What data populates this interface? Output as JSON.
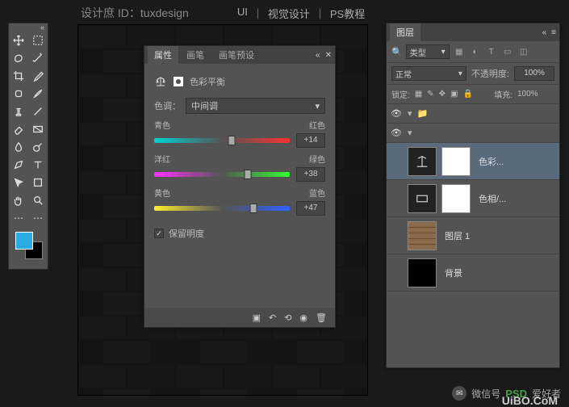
{
  "topbar": {
    "id_label": "设计庶 ID：tuxdesign",
    "sections": [
      "UI",
      "视觉设计",
      "PS教程"
    ]
  },
  "swatch": {
    "fg": "#29abe2"
  },
  "properties": {
    "tabs": [
      "属性",
      "画笔",
      "画笔预设"
    ],
    "title": "色彩平衡",
    "tone_label": "色调：",
    "tone_value": "中间调",
    "sliders": [
      {
        "left": "青色",
        "right": "红色",
        "value": "+14",
        "pos": 57
      },
      {
        "left": "洋红",
        "right": "绿色",
        "value": "+38",
        "pos": 69
      },
      {
        "left": "黄色",
        "right": "蓝色",
        "value": "+47",
        "pos": 73
      }
    ],
    "preserve": "保留明度"
  },
  "layers": {
    "tab": "图层",
    "filter_label": "类型",
    "blend": "正常",
    "opacity_label": "不透明度:",
    "opacity": "100%",
    "lock_label": "锁定:",
    "fill_label": "填充:",
    "fill": "100%",
    "items": [
      {
        "name": "色彩..."
      },
      {
        "name": "色相/..."
      },
      {
        "name": "图层 1"
      },
      {
        "name": "背景"
      }
    ]
  },
  "watermark": {
    "wx": "微信号",
    "brand_left": "PSD",
    "brand_right": "爱好者",
    "site": "UiBO.CoM"
  }
}
